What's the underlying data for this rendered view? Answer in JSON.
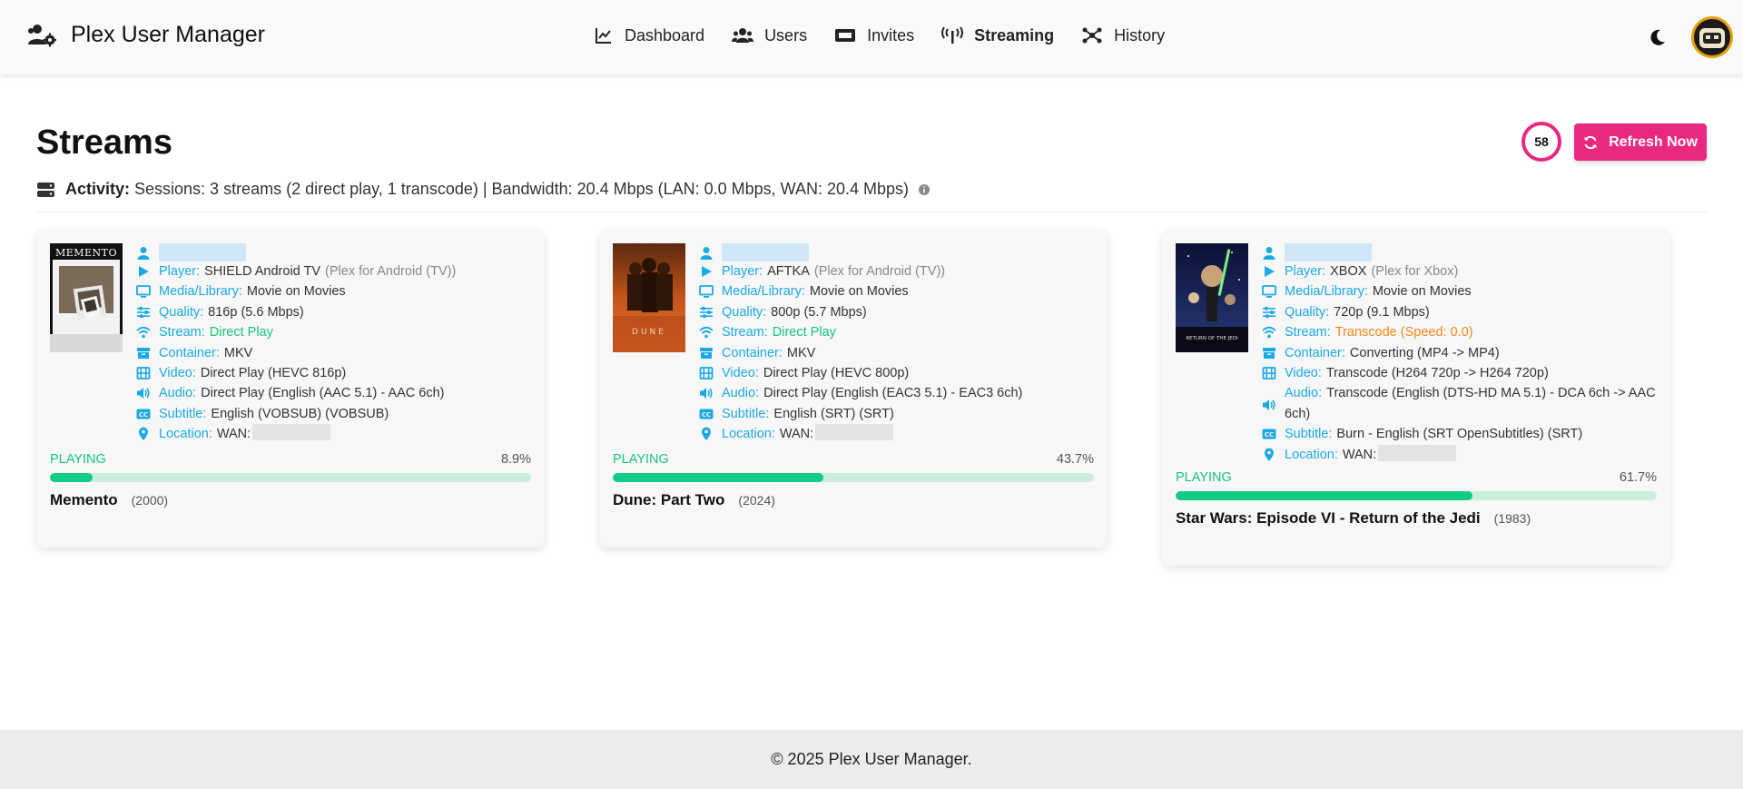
{
  "app": {
    "title": "Plex User Manager"
  },
  "nav": {
    "dashboard": "Dashboard",
    "users": "Users",
    "invites": "Invites",
    "streaming": "Streaming",
    "history": "History",
    "active": "Streaming"
  },
  "page": {
    "title": "Streams",
    "refresh_countdown": "58",
    "refresh_label": "Refresh Now",
    "activity_label": "Activity:",
    "activity_text": "Sessions: 3 streams (2 direct play, 1 transcode) | Bandwidth: 20.4 Mbps (LAN: 0.0 Mbps, WAN: 20.4 Mbps)"
  },
  "labels": {
    "player": "Player:",
    "media": "Media/Library:",
    "quality": "Quality:",
    "stream": "Stream:",
    "container": "Container:",
    "video": "Video:",
    "audio": "Audio:",
    "subtitle": "Subtitle:",
    "location": "Location:"
  },
  "streams": [
    {
      "player": "SHIELD Android TV",
      "player_app": "(Plex for Android (TV))",
      "media": "Movie on Movies",
      "quality": "816p (5.6 Mbps)",
      "stream": "Direct Play",
      "stream_color": "#1ac47a",
      "container": "MKV",
      "video": "Direct Play (HEVC 816p)",
      "audio": "Direct Play (English (AAC 5.1) - AAC 6ch)",
      "subtitle": "English (VOBSUB) (VOBSUB)",
      "location": "WAN:",
      "state": "PLAYING",
      "progress_label": "8.9%",
      "progress": 8.9,
      "title": "Memento",
      "year": "(2000)",
      "poster_text": "MEMENTO"
    },
    {
      "player": "AFTKA",
      "player_app": "(Plex for Android (TV))",
      "media": "Movie on Movies",
      "quality": "800p (5.7 Mbps)",
      "stream": "Direct Play",
      "stream_color": "#1ac47a",
      "container": "MKV",
      "video": "Direct Play (HEVC 800p)",
      "audio": "Direct Play (English (EAC3 5.1) - EAC3 6ch)",
      "subtitle": "English (SRT) (SRT)",
      "location": "WAN:",
      "state": "PLAYING",
      "progress_label": "43.7%",
      "progress": 43.7,
      "title": "Dune: Part Two",
      "year": "(2024)",
      "poster_text": "DUNE"
    },
    {
      "player": "XBOX",
      "player_app": "(Plex for Xbox)",
      "media": "Movie on Movies",
      "quality": "720p (9.1 Mbps)",
      "stream": "Transcode (Speed: 0.0)",
      "stream_color": "#f08a1c",
      "container": "Converting (MP4 -> MP4)",
      "video": "Transcode (H264 720p -> H264 720p)",
      "audio": "Transcode (English (DTS-HD MA 5.1) - DCA 6ch -> AAC 6ch)",
      "subtitle": "Burn - English (SRT OpenSubtitles) (SRT)",
      "location": "WAN:",
      "state": "PLAYING",
      "progress_label": "61.7%",
      "progress": 61.7,
      "title": "Star Wars: Episode VI - Return of the Jedi",
      "year": "(1983)",
      "poster_text": "RETURN OF THE JEDI"
    }
  ],
  "footer": {
    "text": "© 2025 Plex User Manager."
  },
  "colors": {
    "accent": "#1aa9e5",
    "brand_pink": "#e9297f",
    "success": "#1ac47a",
    "warning": "#f08a1c"
  },
  "icons": [
    "users-cog-icon",
    "chart-line-icon",
    "users-icon",
    "ticket-icon",
    "broadcast-icon",
    "sitemap-icon",
    "moon-icon",
    "user-icon",
    "play-icon",
    "monitor-icon",
    "sliders-icon",
    "wifi-icon",
    "archive-icon",
    "film-icon",
    "volume-icon",
    "closed-captions-icon",
    "map-pin-icon",
    "sync-icon",
    "server-icon",
    "info-icon"
  ]
}
